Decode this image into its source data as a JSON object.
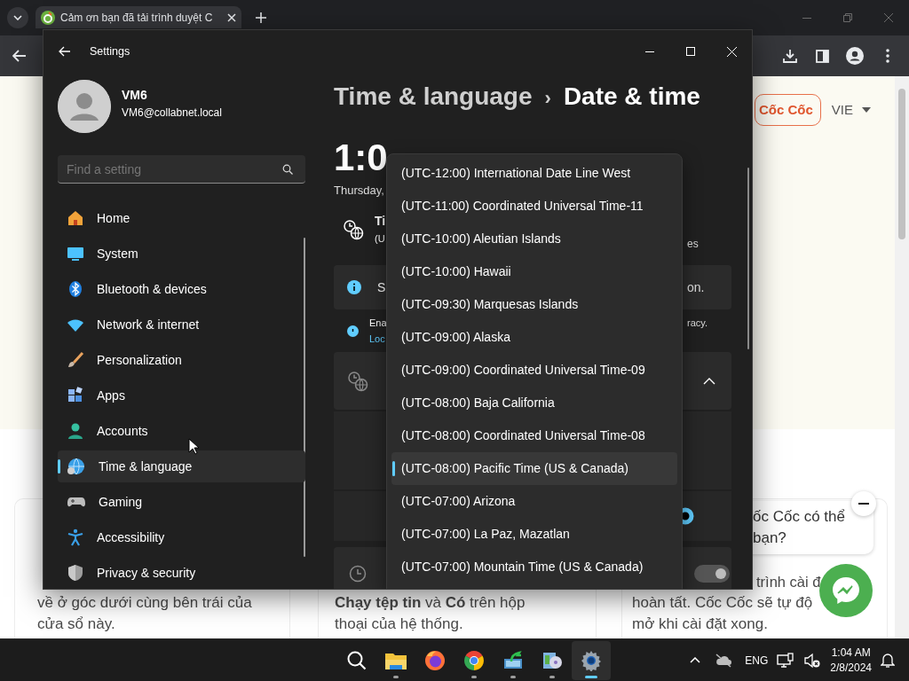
{
  "browser": {
    "tab": {
      "title": "Cảm ơn bạn đã tải trình duyệt C"
    }
  },
  "page": {
    "download_button": "Cốc Cốc",
    "language": "VIE",
    "cards": [
      {
        "lines": [
          "về ở góc dưới cùng bên trái của",
          "cửa sổ này."
        ]
      },
      {
        "lines": [
          "**Chạy tệp tin** và **Có** trên hộp",
          "thoại của hệ thống."
        ]
      },
      {
        "lines": [
          "trình cài đ",
          "hoàn tất. Cốc Cốc sẽ tự độ",
          "mở khi cài đặt xong."
        ]
      }
    ],
    "chat_bubble": {
      "lines": [
        "ốc Cốc có thể",
        "bạn?"
      ]
    }
  },
  "settings": {
    "title": "Settings",
    "user": {
      "name": "VM6",
      "email": "VM6@collabnet.local"
    },
    "search": {
      "placeholder": "Find a setting"
    },
    "nav": [
      {
        "label": "Home",
        "selected": false
      },
      {
        "label": "System",
        "selected": false
      },
      {
        "label": "Bluetooth & devices",
        "selected": false
      },
      {
        "label": "Network & internet",
        "selected": false
      },
      {
        "label": "Personalization",
        "selected": false
      },
      {
        "label": "Apps",
        "selected": false
      },
      {
        "label": "Accounts",
        "selected": false
      },
      {
        "label": "Time & language",
        "selected": true
      },
      {
        "label": "Gaming",
        "selected": false
      },
      {
        "label": "Accessibility",
        "selected": false
      },
      {
        "label": "Privacy & security",
        "selected": false
      }
    ],
    "breadcrumb": {
      "parent": "Time & language",
      "separator": "›",
      "current": "Date & time"
    },
    "clock": {
      "time": "1:0",
      "date": "Thursday,"
    },
    "time_zone_row": {
      "title": "Ti",
      "subtitle": "(U",
      "trailing": "es"
    },
    "info_bar": {
      "text": "S",
      "trailing": "on."
    },
    "location_note": {
      "text": "Ena",
      "link": "Loc",
      "trailing": "racy."
    },
    "time_zone_expander": {
      "expanded": true
    },
    "time_zone_radio": {
      "selected": true
    },
    "auto_time_toggle": {
      "on": true,
      "disabled": true
    },
    "time_zone_dropdown": {
      "items": [
        {
          "label": "(UTC-12:00) International Date Line West",
          "selected": false
        },
        {
          "label": "(UTC-11:00) Coordinated Universal Time-11",
          "selected": false
        },
        {
          "label": "(UTC-10:00) Aleutian Islands",
          "selected": false
        },
        {
          "label": "(UTC-10:00) Hawaii",
          "selected": false
        },
        {
          "label": "(UTC-09:30) Marquesas Islands",
          "selected": false
        },
        {
          "label": "(UTC-09:00) Alaska",
          "selected": false
        },
        {
          "label": "(UTC-09:00) Coordinated Universal Time-09",
          "selected": false
        },
        {
          "label": "(UTC-08:00) Baja California",
          "selected": false
        },
        {
          "label": "(UTC-08:00) Coordinated Universal Time-08",
          "selected": false
        },
        {
          "label": "(UTC-08:00) Pacific Time (US & Canada)",
          "selected": true
        },
        {
          "label": "(UTC-07:00) Arizona",
          "selected": false
        },
        {
          "label": "(UTC-07:00) La Paz, Mazatlan",
          "selected": false
        },
        {
          "label": "(UTC-07:00) Mountain Time (US & Canada)",
          "selected": false
        }
      ]
    }
  },
  "taskbar": {
    "apps": [
      {
        "kind": "search",
        "running": false,
        "active": false
      },
      {
        "kind": "files",
        "running": true,
        "active": false
      },
      {
        "kind": "firefox",
        "running": false,
        "active": false
      },
      {
        "kind": "chrome",
        "running": true,
        "active": false
      },
      {
        "kind": "transfer",
        "running": true,
        "active": false
      },
      {
        "kind": "installer",
        "running": true,
        "active": false
      },
      {
        "kind": "settings",
        "running": true,
        "active": true
      }
    ],
    "language": "ENG",
    "time": "1:04 AM",
    "date": "2/8/2024"
  }
}
